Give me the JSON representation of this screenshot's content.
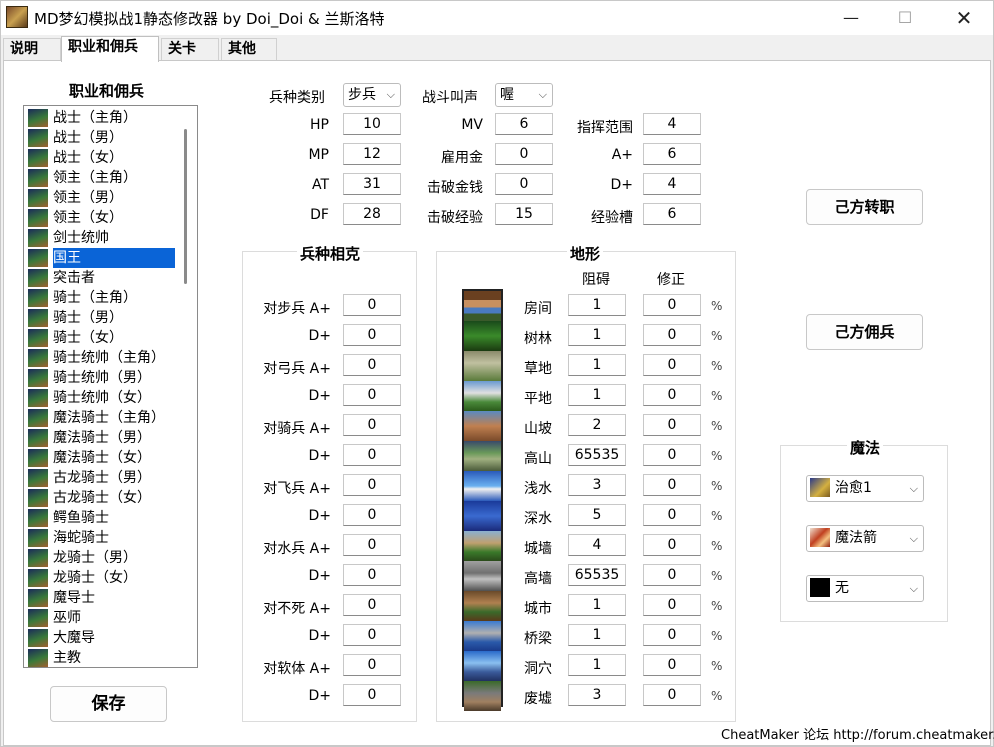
{
  "window": {
    "title": "MD梦幻模拟战1静态修改器 by Doi_Doi & 兰斯洛特",
    "minimize": "—",
    "maximize": "☐",
    "close": "✕"
  },
  "tabs": [
    "说明",
    "职业和佣兵",
    "关卡",
    "其他"
  ],
  "job_list": {
    "header": "职业和佣兵",
    "items": [
      "战士（主角）",
      "战士（男）",
      "战士（女）",
      "领主（主角）",
      "领主（男）",
      "领主（女）",
      "剑士统帅",
      "国王",
      "突击者",
      "骑士（主角）",
      "骑士（男）",
      "骑士（女）",
      "骑士统帅（主角）",
      "骑士统帅（男）",
      "骑士统帅（女）",
      "魔法骑士（主角）",
      "魔法骑士（男）",
      "魔法骑士（女）",
      "古龙骑士（男）",
      "古龙骑士（女）",
      "鳄鱼骑士",
      "海蛇骑士",
      "龙骑士（男）",
      "龙骑士（女）",
      "魔导士",
      "巫师",
      "大魔导",
      "主教"
    ],
    "selected_index": 7
  },
  "save_button": "保存",
  "stats": {
    "unit_type_label": "兵种类别",
    "unit_type_value": "步兵",
    "battle_cry_label": "战斗叫声",
    "battle_cry_value": "喔",
    "rows": [
      {
        "l1": "HP",
        "v1": "10",
        "l2": "MV",
        "v2": "6",
        "l3": "指挥范围",
        "v3": "4"
      },
      {
        "l1": "MP",
        "v1": "12",
        "l2": "雇用金",
        "v2": "0",
        "l3": "A+",
        "v3": "6"
      },
      {
        "l1": "AT",
        "v1": "31",
        "l2": "击破金钱",
        "v2": "0",
        "l3": "D+",
        "v3": "4"
      },
      {
        "l1": "DF",
        "v1": "28",
        "l2": "击破经验",
        "v2": "15",
        "l3": "经验槽",
        "v3": "6"
      }
    ]
  },
  "matchup": {
    "header": "兵种相克",
    "rows": [
      {
        "label": "对步兵 A+",
        "a": "0",
        "d_label": "D+",
        "d": "0"
      },
      {
        "label": "对弓兵 A+",
        "a": "0",
        "d_label": "D+",
        "d": "0"
      },
      {
        "label": "对骑兵 A+",
        "a": "0",
        "d_label": "D+",
        "d": "0"
      },
      {
        "label": "对飞兵 A+",
        "a": "0",
        "d_label": "D+",
        "d": "0"
      },
      {
        "label": "对水兵 A+",
        "a": "0",
        "d_label": "D+",
        "d": "0"
      },
      {
        "label": "对不死 A+",
        "a": "0",
        "d_label": "D+",
        "d": "0"
      },
      {
        "label": "对软体 A+",
        "a": "0",
        "d_label": "D+",
        "d": "0"
      }
    ]
  },
  "terrain": {
    "header": "地形",
    "col_block": "阻碍",
    "col_mod": "修正",
    "pct": "%",
    "rows": [
      {
        "name": "房间",
        "block": "1",
        "mod": "0"
      },
      {
        "name": "树林",
        "block": "1",
        "mod": "0"
      },
      {
        "name": "草地",
        "block": "1",
        "mod": "0"
      },
      {
        "name": "平地",
        "block": "1",
        "mod": "0"
      },
      {
        "name": "山坡",
        "block": "2",
        "mod": "0"
      },
      {
        "name": "高山",
        "block": "65535",
        "mod": "0"
      },
      {
        "name": "浅水",
        "block": "3",
        "mod": "0"
      },
      {
        "name": "深水",
        "block": "5",
        "mod": "0"
      },
      {
        "name": "城墙",
        "block": "4",
        "mod": "0"
      },
      {
        "name": "高墙",
        "block": "65535",
        "mod": "0"
      },
      {
        "name": "城市",
        "block": "1",
        "mod": "0"
      },
      {
        "name": "桥梁",
        "block": "1",
        "mod": "0"
      },
      {
        "name": "洞穴",
        "block": "1",
        "mod": "0"
      },
      {
        "name": "废墟",
        "block": "3",
        "mod": "0"
      }
    ]
  },
  "buttons": {
    "job_change": "己方转职",
    "mercenary": "己方佣兵"
  },
  "magic": {
    "header": "魔法",
    "slots": [
      "治愈1",
      "魔法箭",
      "无"
    ]
  },
  "footer": "CheatMaker 论坛 http://forum.cheatmaker.org/"
}
